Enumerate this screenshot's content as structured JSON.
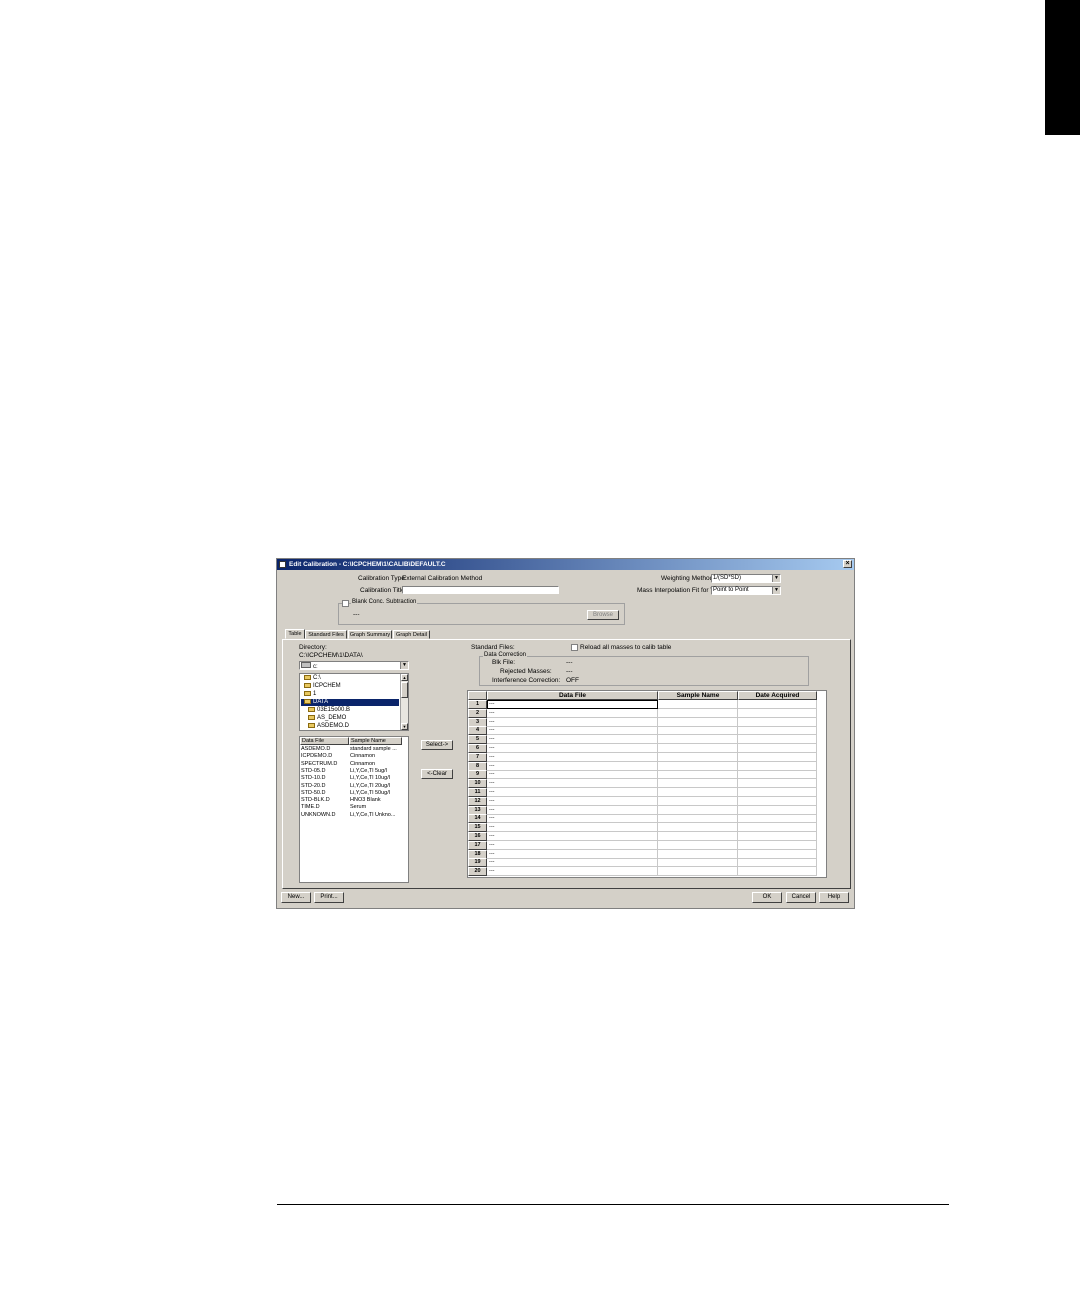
{
  "window": {
    "title": "Edit Calibration - C:\\ICPCHEM\\1\\CALIB\\DEFAULT.C",
    "close_glyph": "×"
  },
  "top": {
    "calibration_type_label": "Calibration Type:",
    "calibration_type_value": "External Calibration Method",
    "calibration_title_label": "Calibration Title:",
    "calibration_title_value": "",
    "weighting_method_label": "Weighting Method:",
    "weighting_method_value": "1/(SD*SD)",
    "mass_interp_label": "Mass Interpolation Fit for VIS:",
    "mass_interp_value": "Point to Point",
    "blank_conc_label": "Blank Conc. Subtraction",
    "blank_value": "---",
    "browse_label": "Browse"
  },
  "tabs": [
    "Table",
    "Standard Files",
    "Graph Summary",
    "Graph Detail"
  ],
  "left": {
    "directory_label": "Directory:",
    "directory_path": "C:\\ICPCHEM\\1\\DATA\\",
    "drive_value": "c:",
    "tree": [
      {
        "label": "C:\\",
        "selected": false
      },
      {
        "label": "ICPCHEM",
        "selected": false
      },
      {
        "label": "1",
        "selected": false
      },
      {
        "label": "DATA",
        "selected": true
      },
      {
        "label": "03E15o00.B",
        "selected": false
      },
      {
        "label": "AS_DEMO",
        "selected": false
      },
      {
        "label": "ASDEMO.D",
        "selected": false
      }
    ],
    "file_headers": [
      "Data File",
      "Sample Name"
    ],
    "files": [
      [
        "ASDEMO.D",
        "standard sample ..."
      ],
      [
        "ICPDEMO.D",
        "Cinnamon"
      ],
      [
        "SPECTRUM.D",
        "Cinnamon"
      ],
      [
        "STD-05.D",
        "Li,Y,Ce,Tl 5ug/l"
      ],
      [
        "STD-10.D",
        "Li,Y,Ce,Tl 10ug/l"
      ],
      [
        "STD-20.D",
        "Li,Y,Ce,Tl 20ug/l"
      ],
      [
        "STD-50.D",
        "Li,Y,Ce,Tl 50ug/l"
      ],
      [
        "STD-BLK.D",
        "HNO3 Blank"
      ],
      [
        "TIME.D",
        "Serum"
      ],
      [
        "UNKNOWN.D",
        "Li,Y,Ce,Tl Unkno..."
      ]
    ]
  },
  "middle": {
    "select_label": "Select->",
    "clear_label": "<-Clear"
  },
  "right": {
    "standard_files_label": "Standard Files:",
    "reload_label": "Reload all masses to calib table",
    "data_correction_label": "Data Correction",
    "blk_file_label": "Blk File:",
    "blk_file_value": "---",
    "rejected_masses_label": "Rejected Masses:",
    "rejected_masses_value": "---",
    "interference_label": "Interference Correction:",
    "interference_value": "OFF",
    "grid_headers": [
      "Data File",
      "Sample Name",
      "Date Acquired"
    ],
    "row_numbers": [
      "1",
      "2",
      "3",
      "4",
      "5",
      "6",
      "7",
      "8",
      "9",
      "10",
      "11",
      "12",
      "13",
      "14",
      "15",
      "16",
      "17",
      "18",
      "19",
      "20"
    ],
    "cell_placeholder": "---"
  },
  "footer": {
    "new_label": "New...",
    "print_label": "Print...",
    "ok_label": "OK",
    "cancel_label": "Cancel",
    "help_label": "Help"
  }
}
